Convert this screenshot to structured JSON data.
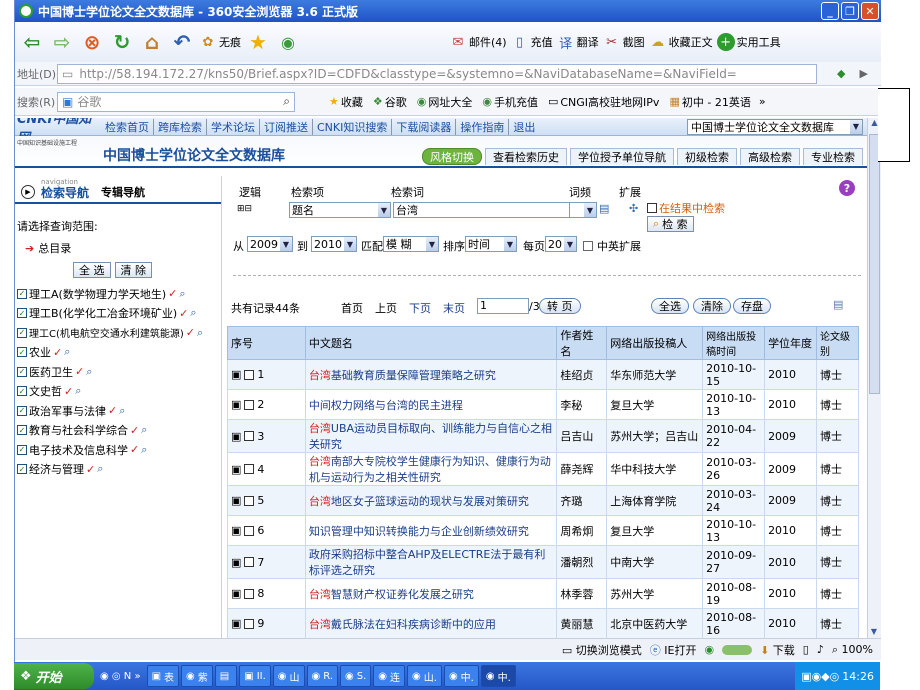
{
  "window": {
    "title": "中国博士学位论文全文数据库 - 360安全浏览器 3.6 正式版"
  },
  "toolbar": {
    "homepage_label": "无痕",
    "mail": "邮件(4)",
    "charge": "充值",
    "translate": "翻译",
    "screenshot": "截图",
    "favorites_text": "收藏正文",
    "tools": "实用工具"
  },
  "address": {
    "label": "地址(D)",
    "url": "http://58.194.172.27/kns50/Brief.aspx?ID=CDFD&classtype=&systemno=&NaviDatabaseName=&NaviField="
  },
  "searchbar": {
    "label": "搜索(R)",
    "placeholder": "谷歌",
    "fav": "收藏",
    "google": "谷歌",
    "nav": "网址大全",
    "phone": "手机充值",
    "cngi": "CNGI高校驻地网IPv",
    "junior": "初中 - 21英语"
  },
  "cnki": {
    "logo": "CNKI中国知网",
    "links": [
      "检索首页",
      "跨库检索",
      "学术论坛",
      "订阅推送",
      "CNKI知识搜索",
      "下载阅读器",
      "操作指南",
      "退出"
    ],
    "db_select": "中国博士学位论文全文数据库",
    "subtitle": "中国知识基础设施工程",
    "db_title": "中国博士学位论文全文数据库",
    "tabs": [
      "风格切换",
      "查看检索历史",
      "学位授予单位导航",
      "初级检索",
      "高级检索",
      "专业检索"
    ]
  },
  "nav": {
    "small": "navigation",
    "title": "检索导航",
    "special": "专辑导航",
    "range_label": "请选择查询范围:",
    "root": "总目录",
    "select_all": "全 选",
    "clear": "清 除",
    "categories": [
      "理工A(数学物理力学天地生)",
      "理工B(化学化工冶金环境矿业)",
      "理工C(机电航空交通水利建筑能源)",
      "农业",
      "医药卫生",
      "文史哲",
      "政治军事与法律",
      "教育与社会科学综合",
      "电子技术及信息科学",
      "经济与管理"
    ]
  },
  "form": {
    "logic": "逻辑",
    "item": "检索项",
    "word": "检索词",
    "freq": "词频",
    "expand": "扩展",
    "field": "题名",
    "term": "台湾",
    "in_result": "在结果中检索",
    "search_btn": "检 索",
    "from": "从",
    "year_from": "2009",
    "to": "到",
    "year_to": "2010",
    "match": "匹配",
    "match_val": "模 糊",
    "sort": "排序",
    "sort_val": "时间",
    "per_page": "每页",
    "per_page_val": "20",
    "cn_en": "中英扩展"
  },
  "pager": {
    "total": "共有记录44条",
    "first": "首页",
    "prev": "上页",
    "next": "下页",
    "last": "末页",
    "page": "1",
    "pages": "/3",
    "goto": "转 页",
    "select_all": "全选",
    "clear": "清除",
    "save": "存盘"
  },
  "table": {
    "headers": [
      "序号",
      "中文题名",
      "作者姓名",
      "网络出版投稿人",
      "网络出版投稿时间",
      "学位年度",
      "论文级别"
    ],
    "rows": [
      {
        "n": "1",
        "pre": "台湾",
        "title": "基础教育质量保障管理策略之研究",
        "author": "桂绍贞",
        "unit": "华东师范大学",
        "date": "2010-10-15",
        "year": "2010",
        "level": "博士"
      },
      {
        "n": "2",
        "pre": "",
        "title": "中间权力网络与台湾的民主进程",
        "author": "李秘",
        "unit": "复旦大学",
        "date": "2010-10-13",
        "year": "2010",
        "level": "博士"
      },
      {
        "n": "3",
        "pre": "台湾",
        "title": "UBA运动员目标取向、训练能力与自信心之相关研究",
        "author": "吕吉山",
        "unit": "苏州大学；吕吉山",
        "date": "2010-04-22",
        "year": "2009",
        "level": "博士"
      },
      {
        "n": "4",
        "pre": "台湾",
        "title": "南部大专院校学生健康行为知识、健康行为动机与运动行为之相关性研究",
        "author": "薛尧辉",
        "unit": "华中科技大学",
        "date": "2010-03-26",
        "year": "2009",
        "level": "博士"
      },
      {
        "n": "5",
        "pre": "台湾",
        "title": "地区女子篮球运动的现状与发展对策研究",
        "author": "齐璐",
        "unit": "上海体育学院",
        "date": "2010-03-24",
        "year": "2009",
        "level": "博士"
      },
      {
        "n": "6",
        "pre": "",
        "title": "知识管理中知识转换能力与企业创新绩效研究",
        "author": "周希炯",
        "unit": "复旦大学",
        "date": "2010-10-13",
        "year": "2010",
        "level": "博士"
      },
      {
        "n": "7",
        "pre": "",
        "title": "政府采购招标中整合AHP及ELECTRE法于最有利标评选之研究",
        "author": "潘朝烈",
        "unit": "中南大学",
        "date": "2010-09-27",
        "year": "2010",
        "level": "博士"
      },
      {
        "n": "8",
        "pre": "台湾",
        "title": "智慧财产权证券化发展之研究",
        "author": "林季蓉",
        "unit": "苏州大学",
        "date": "2010-08-19",
        "year": "2010",
        "level": "博士"
      },
      {
        "n": "9",
        "pre": "台湾",
        "title": "戴氏脉法在妇科疾病诊断中的应用",
        "author": "黄丽慧",
        "unit": "北京中医药大学",
        "date": "2010-08-16",
        "year": "2010",
        "level": "博士"
      }
    ]
  },
  "status": {
    "switch": "切换浏览模式",
    "ie": "IE打开",
    "download": "下载",
    "zoom": "100%"
  },
  "taskbar": {
    "start": "开始",
    "tasks": [
      "表",
      "紫",
      "",
      "II.",
      "山",
      "R.",
      "S.",
      "连",
      "山.",
      "中.",
      "中."
    ],
    "time": "14:26"
  }
}
